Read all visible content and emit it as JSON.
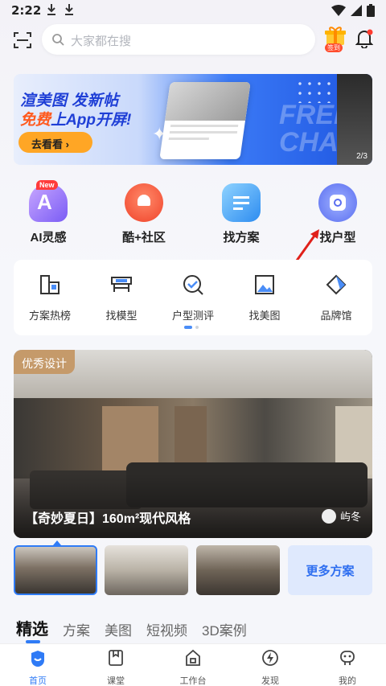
{
  "status": {
    "time": "2:22"
  },
  "header": {
    "search_placeholder": "大家都在搜",
    "gift_badge": "签到"
  },
  "banner": {
    "line1": "渲美图 发新帖",
    "line2_highlight": "免费",
    "line2_rest": "上App开屏!",
    "button": "去看看 ›",
    "decor_text": "FREE CHA",
    "page_indicator": "2/3"
  },
  "quick_actions": [
    {
      "label": "AI灵感",
      "badge": "New",
      "icon": "ai-inspiration-icon"
    },
    {
      "label": "酷+社区",
      "icon": "community-icon"
    },
    {
      "label": "找方案",
      "icon": "plan-icon"
    },
    {
      "label": "找户型",
      "icon": "floorplan-icon"
    }
  ],
  "tools": [
    {
      "label": "方案热榜",
      "icon": "ranking-icon"
    },
    {
      "label": "找模型",
      "icon": "model-icon"
    },
    {
      "label": "户型测评",
      "icon": "evaluation-icon"
    },
    {
      "label": "找美图",
      "icon": "image-icon"
    },
    {
      "label": "品牌馆",
      "icon": "brand-icon"
    }
  ],
  "feature": {
    "tag": "优秀设计",
    "title": "【奇妙夏日】160m²现代风格",
    "author": "屿冬"
  },
  "more_plans": "更多方案",
  "categories": [
    {
      "label": "精选",
      "active": true
    },
    {
      "label": "方案"
    },
    {
      "label": "美图"
    },
    {
      "label": "短视频"
    },
    {
      "label": "3D案例"
    }
  ],
  "bottom_nav": [
    {
      "label": "首页",
      "icon": "home-icon",
      "active": true
    },
    {
      "label": "课堂",
      "icon": "classroom-icon"
    },
    {
      "label": "工作台",
      "icon": "workbench-icon"
    },
    {
      "label": "发现",
      "icon": "discover-icon"
    },
    {
      "label": "我的",
      "icon": "profile-icon"
    }
  ],
  "colors": {
    "accent": "#2f7bf6",
    "banner_button": "#ffa625",
    "tag": "#c59a6a"
  }
}
